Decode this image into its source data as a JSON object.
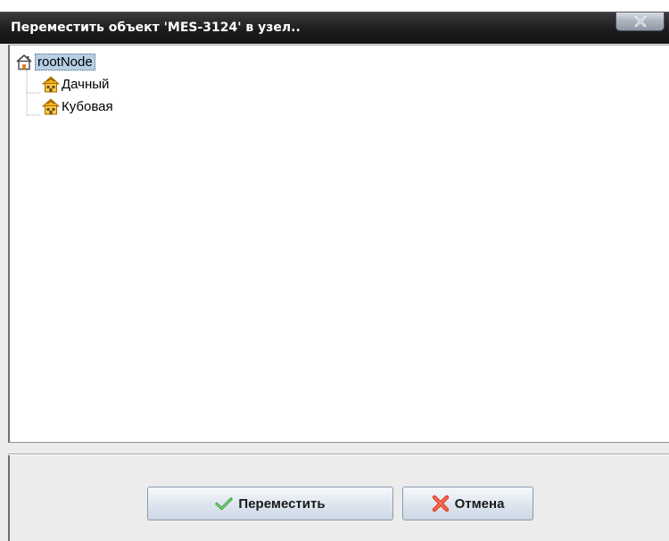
{
  "dialog": {
    "title": "Переместить объект 'MES-3124' в узел..",
    "close_icon": "close-icon"
  },
  "tree": {
    "root": {
      "label": "rootNode",
      "icon": "home-icon",
      "selected": true
    },
    "children": [
      {
        "label": "Дачный",
        "icon": "house-group-icon"
      },
      {
        "label": "Кубовая",
        "icon": "house-group-icon"
      }
    ]
  },
  "buttons": {
    "move_label": "Переместить",
    "move_icon": "checkmark-icon",
    "cancel_label": "Отмена",
    "cancel_icon": "cross-icon"
  },
  "colors": {
    "titlebar": "#1c1c1c",
    "selection": "#b8cfe5",
    "check": "#3aa63a",
    "cross": "#e0452a"
  }
}
